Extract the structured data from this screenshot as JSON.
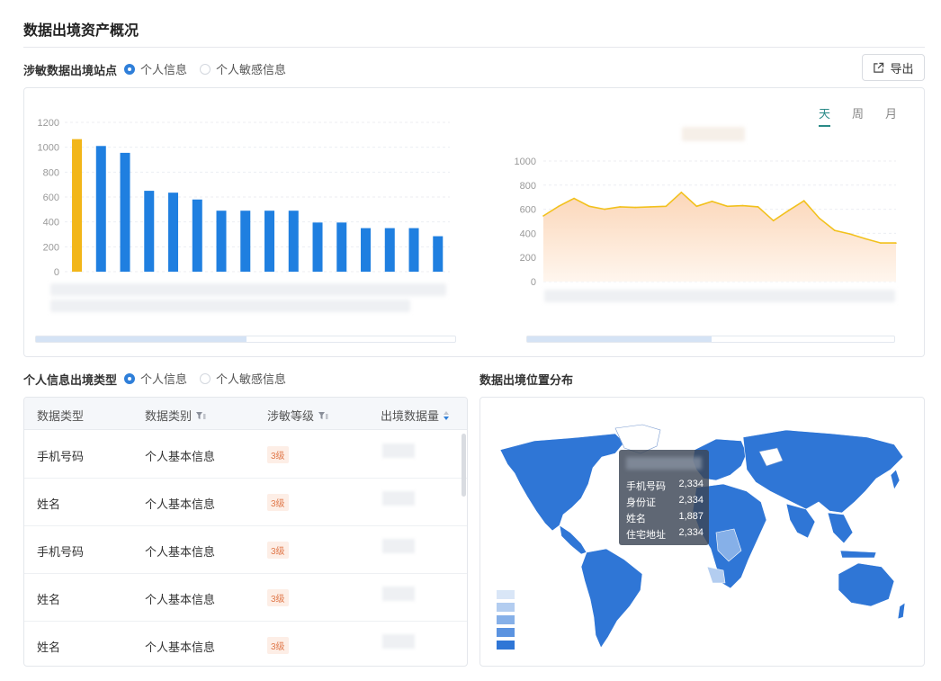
{
  "page": {
    "title": "数据出境资产概况",
    "export_label": "导出"
  },
  "top_section": {
    "label": "涉敏数据出境站点",
    "radio": [
      {
        "label": "个人信息",
        "checked": true
      },
      {
        "label": "个人敏感信息",
        "checked": false
      }
    ]
  },
  "time_tabs": [
    {
      "label": "天",
      "active": true
    },
    {
      "label": "周",
      "active": false
    },
    {
      "label": "月",
      "active": false
    }
  ],
  "chart_data": [
    {
      "type": "bar",
      "yticks": [
        "0",
        "200",
        "400",
        "600",
        "800",
        "1000",
        "1200"
      ],
      "ylim": [
        0,
        1200
      ],
      "values": [
        1065,
        1010,
        955,
        650,
        635,
        580,
        490,
        490,
        490,
        490,
        395,
        395,
        350,
        350,
        350,
        285
      ],
      "highlight_index": 0,
      "colors": {
        "bar": "#1f7fe0",
        "highlight": "#f2b619"
      },
      "grid": true
    },
    {
      "type": "area",
      "yticks": [
        "0",
        "200",
        "400",
        "600",
        "800",
        "1000"
      ],
      "ylim": [
        0,
        1000
      ],
      "values": [
        545,
        625,
        690,
        625,
        600,
        620,
        615,
        620,
        625,
        740,
        625,
        665,
        625,
        630,
        620,
        505,
        590,
        670,
        525,
        425,
        395,
        355,
        320,
        320
      ],
      "colors": {
        "line": "#f2c11d",
        "fill_top": "#fbd6b8",
        "fill_bottom": "#fff6ee"
      },
      "grid": true
    }
  ],
  "bottom_left": {
    "label": "个人信息出境类型",
    "radio": [
      {
        "label": "个人信息",
        "checked": true
      },
      {
        "label": "个人敏感信息",
        "checked": false
      }
    ]
  },
  "table": {
    "headers": [
      "数据类型",
      "数据类别",
      "涉敏等级",
      "出境数据量"
    ],
    "rows": [
      {
        "type": "手机号码",
        "category": "个人基本信息",
        "level": "3级"
      },
      {
        "type": "姓名",
        "category": "个人基本信息",
        "level": "3级"
      },
      {
        "type": "手机号码",
        "category": "个人基本信息",
        "level": "3级"
      },
      {
        "type": "姓名",
        "category": "个人基本信息",
        "level": "3级"
      },
      {
        "type": "姓名",
        "category": "个人基本信息",
        "level": "3级"
      }
    ]
  },
  "map": {
    "label": "数据出境位置分布",
    "tooltip": [
      {
        "name": "手机号码",
        "value": "2,334"
      },
      {
        "name": "身份证",
        "value": "2,334"
      },
      {
        "name": "姓名",
        "value": "1,887"
      },
      {
        "name": "住宅地址",
        "value": "2,334"
      }
    ],
    "legend_colors": [
      "#d9e6f7",
      "#b3cdf0",
      "#86b0e8",
      "#5b93e0",
      "#2f76d6"
    ],
    "land_color": "#2f76d6"
  }
}
